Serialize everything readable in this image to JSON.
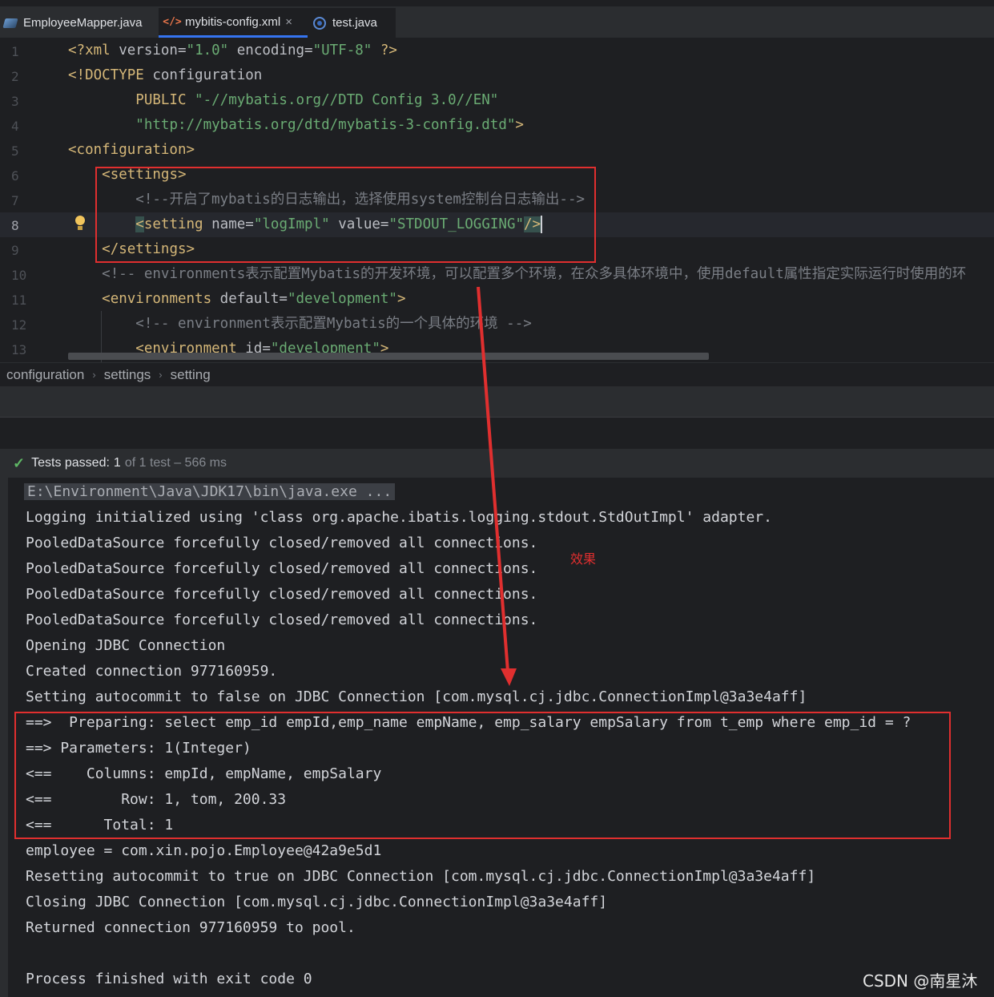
{
  "tabs": [
    {
      "label": "EmployeeMapper.java",
      "icon": "mapper-java-icon"
    },
    {
      "label": "mybitis-config.xml",
      "icon": "xml-file-icon",
      "active": true,
      "close": "×"
    },
    {
      "label": "test.java",
      "icon": "test-java-icon"
    }
  ],
  "gutter": [
    "1",
    "2",
    "3",
    "4",
    "5",
    "6",
    "7",
    "8",
    "9",
    "10",
    "11",
    "12",
    "13"
  ],
  "code": {
    "l1": {
      "a": "<?xml ",
      "b": "version",
      "c": "=",
      "d": "\"1.0\"",
      "e": " encoding",
      "f": "=",
      "g": "\"UTF-8\"",
      "h": " ?>"
    },
    "l2": {
      "a": "<!DOCTYPE ",
      "b": "configuration"
    },
    "l3": {
      "a": "        PUBLIC ",
      "b": "\"-//mybatis.org//DTD Config 3.0//EN\""
    },
    "l4": {
      "a": "        ",
      "b": "\"http://mybatis.org/dtd/mybatis-3-config.dtd\"",
      "c": ">"
    },
    "l5": {
      "a": "<configuration>"
    },
    "l6": {
      "a": "    ",
      "b": "<settings>"
    },
    "l7": {
      "a": "        ",
      "b": "<!--开启了mybatis的日志输出，选择使用system控制台日志输出-->"
    },
    "l8": {
      "a": "        ",
      "b": "<",
      "c": "setting",
      "d": " name",
      "e": "=",
      "f": "\"logImpl\"",
      "g": " value",
      "h": "=",
      "i": "\"STDOUT_LOGGING\"",
      "j": "/>"
    },
    "l9": {
      "a": "    ",
      "b": "</settings>"
    },
    "l10": {
      "a": "    ",
      "b": "<!-- environments表示配置Mybatis的开发环境，可以配置多个环境，在众多具体环境中，使用default属性指定实际运行时使用的环"
    },
    "l11": {
      "a": "    ",
      "b": "<environments",
      "c": " default",
      "d": "=",
      "e": "\"development\"",
      "f": ">"
    },
    "l12": {
      "a": "        ",
      "b": "<!-- environment表示配置Mybatis的一个具体的环境 -->"
    },
    "l13": {
      "a": "        ",
      "b": "<environment",
      "c": " id",
      "d": "=",
      "e": "\"development\"",
      "f": ">"
    }
  },
  "breadcrumb": [
    "configuration",
    "settings",
    "setting"
  ],
  "breadcrumb_sep": "›",
  "run": {
    "check": "✓",
    "passed_label": "Tests passed:",
    "passed_count": "1",
    "passed_rest": "of 1 test – 566 ms"
  },
  "console": [
    "E:\\Environment\\Java\\JDK17\\bin\\java.exe ...",
    "Logging initialized using 'class org.apache.ibatis.logging.stdout.StdOutImpl' adapter.",
    "PooledDataSource forcefully closed/removed all connections.",
    "PooledDataSource forcefully closed/removed all connections.",
    "PooledDataSource forcefully closed/removed all connections.",
    "PooledDataSource forcefully closed/removed all connections.",
    "Opening JDBC Connection",
    "Created connection 977160959.",
    "Setting autocommit to false on JDBC Connection [com.mysql.cj.jdbc.ConnectionImpl@3a3e4aff]",
    "==>  Preparing: select emp_id empId,emp_name empName, emp_salary empSalary from t_emp where emp_id = ?",
    "==> Parameters: 1(Integer)",
    "<==    Columns: empId, empName, empSalary",
    "<==        Row: 1, tom, 200.33",
    "<==      Total: 1",
    "employee = com.xin.pojo.Employee@42a9e5d1",
    "Resetting autocommit to true on JDBC Connection [com.mysql.cj.jdbc.ConnectionImpl@3a3e4aff]",
    "Closing JDBC Connection [com.mysql.cj.jdbc.ConnectionImpl@3a3e4aff]",
    "Returned connection 977160959 to pool.",
    "",
    "Process finished with exit code 0"
  ],
  "annotation": {
    "effect": "效果",
    "color": "#e02f2f"
  },
  "watermark": "CSDN @南星沐"
}
